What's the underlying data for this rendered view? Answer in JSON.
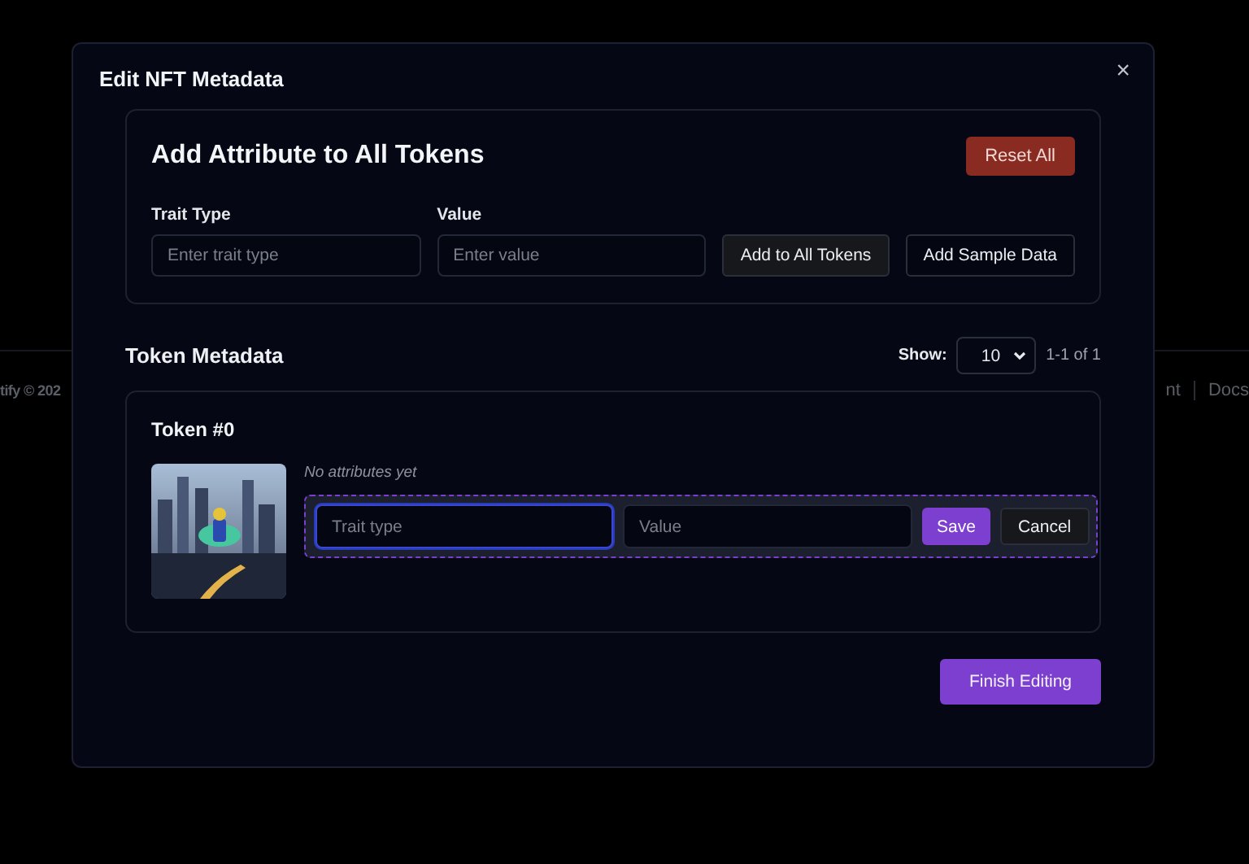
{
  "background_footer": {
    "left_text": "tify © 202",
    "right_links": [
      "nt",
      "Docs"
    ]
  },
  "modal": {
    "title": "Edit NFT Metadata",
    "close": "×",
    "bulk": {
      "title": "Add Attribute to All Tokens",
      "reset": "Reset All",
      "fields": [
        {
          "label": "Trait Type",
          "placeholder": "Enter trait type"
        },
        {
          "label": "Value",
          "placeholder": "Enter value"
        }
      ],
      "buttons": [
        "Add to All Tokens",
        "Add Sample Data"
      ]
    },
    "tokens_header": {
      "title": "Token Metadata",
      "show_label": "Show:",
      "page_size": "10",
      "range": "1-1 of 1"
    },
    "tokens": [
      {
        "name": "Token #0",
        "empty_note": "No attributes yet",
        "editor": {
          "fields": [
            {
              "placeholder": "Trait type",
              "focused": true
            },
            {
              "placeholder": "Value",
              "focused": false
            }
          ],
          "save": "Save",
          "cancel": "Cancel"
        }
      }
    ],
    "finish": "Finish Editing"
  }
}
